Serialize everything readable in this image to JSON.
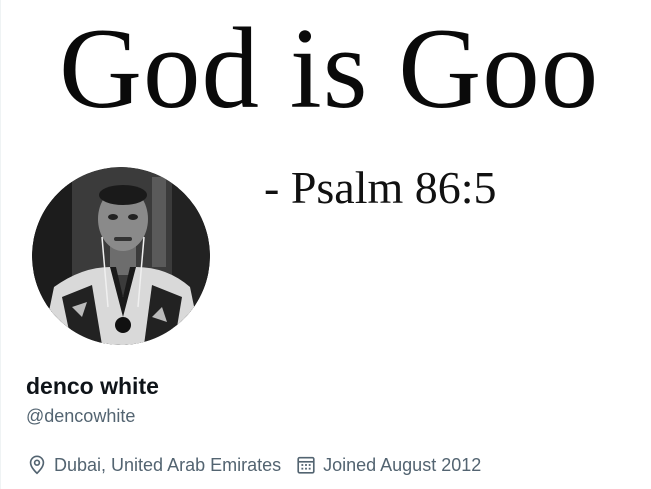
{
  "banner": {
    "headline": "God is Goo",
    "attribution": "- Psalm 86:5"
  },
  "profile": {
    "display_name": "denco white",
    "handle": "@dencowhite",
    "location": "Dubai, United Arab Emirates",
    "joined": "Joined August 2012",
    "avatar_icon": "profile-photo"
  },
  "icons": {
    "location": "location-pin-icon",
    "joined": "calendar-icon"
  },
  "colors": {
    "text_primary": "#0f1419",
    "text_secondary": "#536471",
    "background": "#ffffff"
  }
}
